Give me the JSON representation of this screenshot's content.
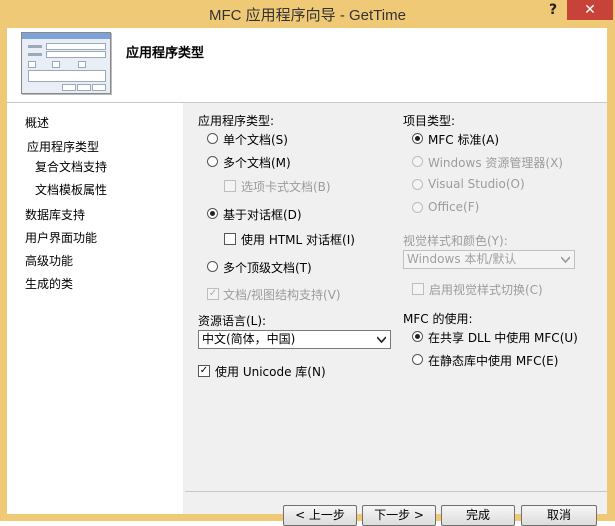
{
  "window": {
    "title": "MFC 应用程序向导 - GetTime",
    "help_glyph": "?",
    "close_glyph": "✕"
  },
  "header": {
    "page_title": "应用程序类型"
  },
  "sidebar": {
    "items": [
      {
        "label": "概述"
      },
      {
        "label": "应用程序类型"
      },
      {
        "label": "复合文档支持"
      },
      {
        "label": "文档模板属性"
      },
      {
        "label": "数据库支持"
      },
      {
        "label": "用户界面功能"
      },
      {
        "label": "高级功能"
      },
      {
        "label": "生成的类"
      }
    ]
  },
  "app_type": {
    "group_label": "应用程序类型:",
    "single_doc": "单个文档(S)",
    "multi_doc": "多个文档(M)",
    "tabbed_docs": "选项卡式文档(B)",
    "dialog_based": "基于对话框(D)",
    "use_html_dialog": "使用 HTML 对话框(I)",
    "multi_top_level": "多个顶级文档(T)",
    "doc_view_support": "文档/视图结构支持(V)",
    "selected": "基于对话框(D)"
  },
  "resource_language": {
    "label": "资源语言(L):",
    "value": "中文(简体，中国)"
  },
  "unicode": {
    "label": "使用 Unicode 库(N)",
    "checked": true
  },
  "project_type": {
    "group_label": "项目类型:",
    "mfc_standard": "MFC 标准(A)",
    "windows_explorer": "Windows 资源管理器(X)",
    "visual_studio": "Visual Studio(O)",
    "office": "Office(F)",
    "selected": "MFC 标准(A)"
  },
  "visual_style": {
    "label": "视觉样式和颜色(Y):",
    "value": "Windows 本机/默认",
    "enable_switch": "启用视觉样式切换(C)"
  },
  "mfc_usage": {
    "group_label": "MFC 的使用:",
    "shared_dll": "在共享 DLL 中使用 MFC(U)",
    "static_lib": "在静态库中使用 MFC(E)",
    "selected": "在共享 DLL 中使用 MFC(U)"
  },
  "buttons": {
    "prev": "< 上一步",
    "next": "下一步 >",
    "finish": "完成",
    "cancel": "取消"
  },
  "colors": {
    "titlebar": "#f0c977",
    "close": "#c7433a",
    "panel": "#f0f0f0"
  }
}
